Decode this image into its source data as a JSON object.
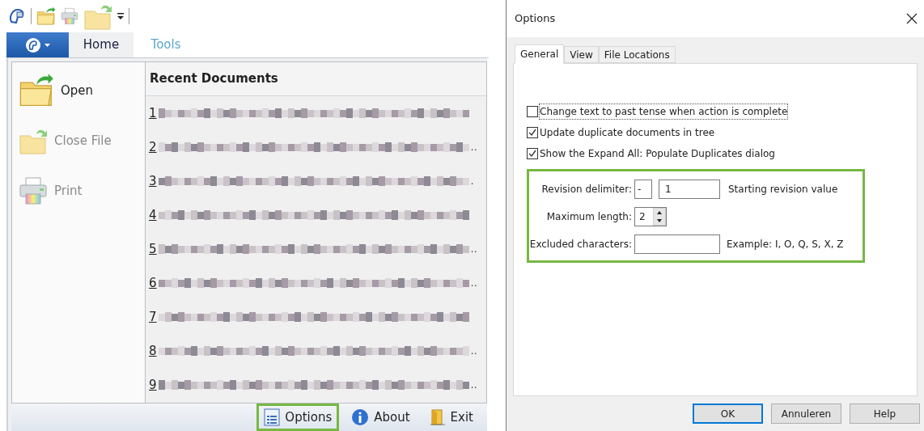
{
  "quick_access": [
    {
      "kind": "logo"
    },
    {
      "kind": "open"
    },
    {
      "kind": "print"
    },
    {
      "kind": "close"
    },
    {
      "kind": "more"
    }
  ],
  "ribbon_tabs": [
    {
      "kind": "app"
    },
    {
      "kind": "tab",
      "label": "Home",
      "selected": true
    },
    {
      "kind": "tab",
      "label": "Tools",
      "selected": false
    }
  ],
  "backstage": {
    "commands": [
      {
        "kind": "open",
        "label": "Open",
        "disabled": false
      },
      {
        "kind": "close",
        "label": "Close File",
        "disabled": true
      },
      {
        "kind": "print",
        "label": "Print",
        "disabled": true
      }
    ],
    "recent_title": "Recent Documents",
    "recent": [
      {
        "number": "1"
      },
      {
        "number": "2",
        "trail": ".."
      },
      {
        "number": "3",
        "trail": "."
      },
      {
        "number": "4"
      },
      {
        "number": "5",
        "trail": ".."
      },
      {
        "number": "6",
        "trail": ".."
      },
      {
        "number": "7"
      },
      {
        "number": "8",
        "trail": ".."
      },
      {
        "number": "9",
        "trail": ".."
      }
    ],
    "footer": [
      {
        "kind": "options",
        "label": "Options",
        "highlighted": true
      },
      {
        "kind": "about",
        "label": "About",
        "highlighted": false
      },
      {
        "kind": "exit",
        "label": "Exit",
        "highlighted": false
      }
    ]
  },
  "dialog": {
    "title": "Options",
    "tabs": [
      {
        "label": "General",
        "selected": true
      },
      {
        "label": "View",
        "selected": false
      },
      {
        "label": "File Locations",
        "selected": false
      }
    ],
    "checkboxes": [
      {
        "label": "Change text to past tense when action is complete",
        "checked": false,
        "focused": true
      },
      {
        "label": "Update duplicate documents in tree",
        "checked": true,
        "focused": false
      },
      {
        "label": "Show the Expand All: Populate Duplicates dialog",
        "checked": true,
        "focused": false
      }
    ],
    "revision_group": {
      "highlighted": true,
      "delimiter_label": "Revision delimiter:",
      "delimiter_value": "-",
      "start_value": "1",
      "start_label": "Starting revision value",
      "max_length_label": "Maximum length:",
      "max_length_value": "2",
      "excluded_label": "Excluded characters:",
      "excluded_example": "Example: I, O, Q, S, X, Z"
    },
    "buttons": [
      {
        "label": "OK",
        "default": true
      },
      {
        "label": "Annuleren",
        "default": false
      },
      {
        "label": "Help",
        "default": false
      }
    ]
  }
}
